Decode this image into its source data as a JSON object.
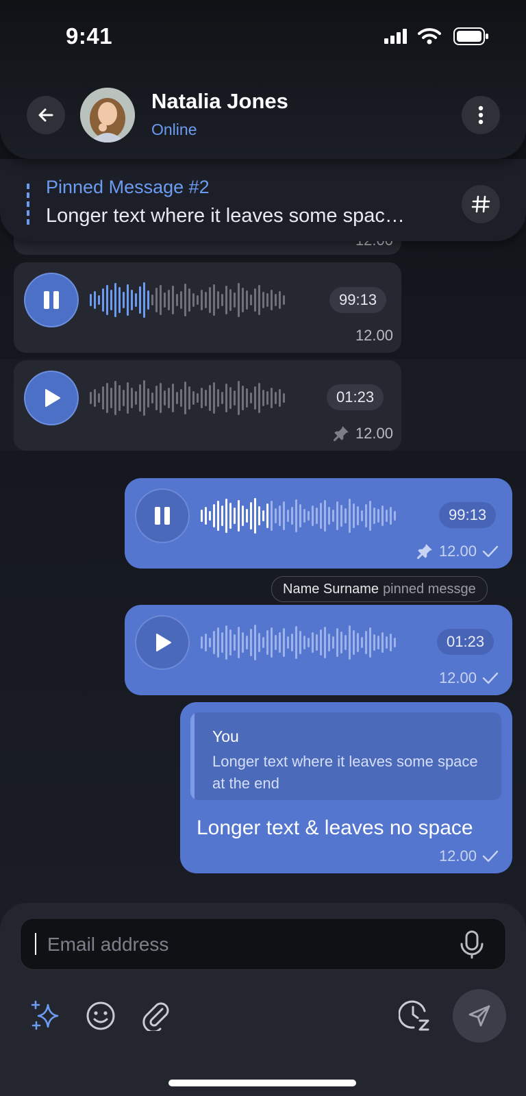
{
  "status_bar": {
    "time": "9:41"
  },
  "header": {
    "name": "Natalia Jones",
    "status": "Online"
  },
  "pinned": {
    "title": "Pinned Message #2",
    "text": "Longer text where it leaves some spac…"
  },
  "messages": {
    "in_partial": {
      "time": "12.00"
    },
    "in_voice_1": {
      "duration": "99:13",
      "time": "12.00",
      "playing": true,
      "progress": 0.3
    },
    "in_voice_2": {
      "duration": "01:23",
      "time": "12.00",
      "pinned": true
    },
    "out_voice_1": {
      "duration": "99:13",
      "time": "12.00",
      "playing": true,
      "progress": 0.35,
      "pinned": true
    },
    "system": {
      "name": "Name Surname",
      "action": "pinned messge"
    },
    "out_voice_2": {
      "duration": "01:23",
      "time": "12.00"
    },
    "out_reply": {
      "reply_author": "You",
      "reply_text": "Longer text where it leaves some space at the end",
      "text": "Longer text & leaves no space",
      "time": "12.00"
    }
  },
  "composer": {
    "placeholder": "Email address"
  },
  "icons": [
    "back-arrow-icon",
    "more-vertical-icon",
    "hashtag-icon",
    "pause-icon",
    "play-icon",
    "pin-icon",
    "check-icon",
    "microphone-icon",
    "sparkles-icon",
    "emoji-icon",
    "paperclip-icon",
    "schedule-clock-icon",
    "send-icon",
    "signal-icon",
    "wifi-icon",
    "battery-icon"
  ],
  "colors": {
    "accent": "#5476cf",
    "link": "#6b9cf2",
    "incoming": "#252831"
  }
}
